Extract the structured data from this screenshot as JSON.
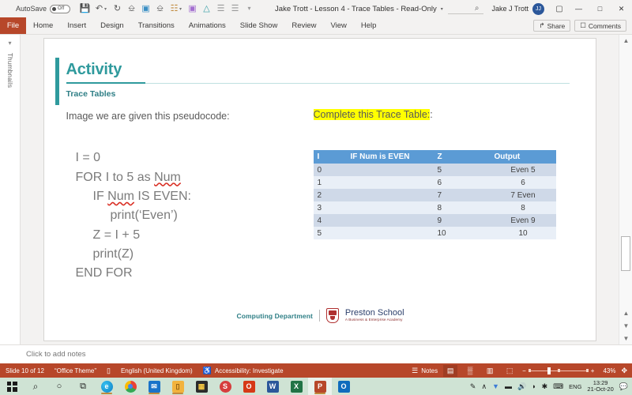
{
  "titlebar": {
    "autosave_label": "AutoSave",
    "autosave_state": "Off",
    "document_title": "Jake Trott - Lesson 4 - Trace Tables  -  Read-Only",
    "title_caret": "▾",
    "search_icon": "⌕",
    "account_name": "Jake J Trott",
    "avatar_initials": "JJ",
    "quick_access": [
      {
        "name": "save-icon",
        "glyph": "Ὃe"
      },
      {
        "name": "undo-icon",
        "glyph": "↶"
      },
      {
        "name": "redo-icon",
        "glyph": "↻"
      },
      {
        "name": "start-presentation-icon",
        "glyph": "⬚"
      },
      {
        "name": "text-box-icon",
        "glyph": "▣"
      },
      {
        "name": "new-slide-icon",
        "glyph": "⬚"
      },
      {
        "name": "picture-icon",
        "glyph": "Ὓc"
      },
      {
        "name": "shapes-icon",
        "glyph": "◰"
      },
      {
        "name": "format-painter-icon",
        "glyph": "✐"
      },
      {
        "name": "align-left-icon",
        "glyph": "☰"
      },
      {
        "name": "align-center-icon",
        "glyph": "☰"
      },
      {
        "name": "customize-qat-icon",
        "glyph": "☰"
      }
    ],
    "window_buttons": {
      "ribbon_display": "▢",
      "minimize": "—",
      "restore": "□",
      "close": "✕"
    }
  },
  "ribbon": {
    "file_label": "File",
    "tabs": [
      "Home",
      "Insert",
      "Design",
      "Transitions",
      "Animations",
      "Slide Show",
      "Review",
      "View",
      "Help"
    ],
    "share_label": "Share",
    "share_icon": "↱",
    "comments_label": "Comments",
    "comments_icon": "὞a"
  },
  "thumbnails_pane": {
    "label": "Thumbnails",
    "chevron": "▾"
  },
  "slide": {
    "title": "Activity",
    "subtitle": "Trace Tables",
    "prompt_left": "Image we are given this pseudocode:",
    "prompt_right": "Complete this Trace Table:",
    "code_lines": [
      {
        "indent": 0,
        "text": "I = 0"
      },
      {
        "indent": 0,
        "pre": "FOR I to 5 as ",
        "squiggle": "Num",
        "post": ""
      },
      {
        "indent": 1,
        "pre": "IF ",
        "squiggle": "Num",
        "post": " IS EVEN:"
      },
      {
        "indent": 2,
        "text": "print(‘Even’)"
      },
      {
        "indent": 1,
        "text": "Z = I + 5"
      },
      {
        "indent": 1,
        "text": "print(Z)"
      },
      {
        "indent": 0,
        "text": "END FOR"
      }
    ],
    "footer": {
      "department": "Computing Department",
      "school_name": "Preston School",
      "school_tagline": "A Business & Enterprise Academy"
    },
    "accent_color": "#2f9a9d",
    "highlight_color": "#ffff00"
  },
  "trace_table": {
    "headers": [
      "I",
      "IF Num is EVEN",
      "Z",
      "Output"
    ],
    "rows": [
      [
        "0",
        "",
        "5",
        "Even  5"
      ],
      [
        "1",
        "",
        "6",
        "6"
      ],
      [
        "2",
        "",
        "7",
        "7 Even"
      ],
      [
        "3",
        "",
        "8",
        "8"
      ],
      [
        "4",
        "",
        "9",
        "Even 9"
      ],
      [
        "5",
        "",
        "10",
        "10"
      ]
    ],
    "header_bg": "#5b9bd5",
    "row_odd_bg": "#cfd9e8",
    "row_even_bg": "#e9eff7"
  },
  "notes": {
    "placeholder": "Click to add notes"
  },
  "statusbar": {
    "slide_counter": "Slide 10 of 12",
    "theme": "“Office Theme”",
    "language": "English (United Kingdom)",
    "accessibility": "Accessibility: Investigate",
    "accessibility_icon": "♿",
    "theme_icon": "⬚",
    "notes_label": "Notes",
    "notes_icon": "☰",
    "view_normal_icon": "▤",
    "view_sorter_icon": "▒",
    "view_reading_icon": "▥",
    "view_show_icon": "⬚",
    "zoom_out": "−",
    "zoom_in": "+",
    "zoom_level": "43%",
    "fit_icon": "✥",
    "bg_color": "#b7472a"
  },
  "taskbar": {
    "items": [
      {
        "name": "start-button",
        "glyph": "",
        "label": "Start",
        "color": ""
      },
      {
        "name": "search-icon",
        "glyph": "⌕",
        "label": "Search",
        "color": ""
      },
      {
        "name": "cortana-icon",
        "glyph": "○",
        "label": "Cortana",
        "color": ""
      },
      {
        "name": "task-view-icon",
        "glyph": "⧉",
        "label": "Task View",
        "color": ""
      },
      {
        "name": "edge-icon",
        "glyph": "e",
        "label": "Microsoft Edge",
        "color": "#0f8fcf"
      },
      {
        "name": "chrome-icon",
        "glyph": "●",
        "label": "Google Chrome",
        "color": "#dd4b3e"
      },
      {
        "name": "mail-icon",
        "glyph": "✉",
        "label": "Mail",
        "color": "#1a73c9"
      },
      {
        "name": "file-explorer-icon",
        "glyph": "▭",
        "label": "File Explorer",
        "color": "#f2b33d"
      },
      {
        "name": "microsoft-store-icon",
        "glyph": "Ὤd",
        "label": "Microsoft Store",
        "color": "#2b2b2b"
      },
      {
        "name": "skype-icon",
        "glyph": "S",
        "label": "Skype",
        "color": "#d63d3d"
      },
      {
        "name": "office-icon",
        "glyph": "O",
        "label": "Office",
        "color": "#d63916"
      },
      {
        "name": "word-icon",
        "glyph": "W",
        "label": "Word",
        "color": "#2b579a"
      },
      {
        "name": "excel-icon",
        "glyph": "X",
        "label": "Excel",
        "color": "#217346"
      },
      {
        "name": "powerpoint-icon",
        "glyph": "P",
        "label": "PowerPoint",
        "color": "#b7472a",
        "active": true
      },
      {
        "name": "outlook-icon",
        "glyph": "O",
        "label": "Outlook",
        "color": "#0f6cbd"
      }
    ],
    "tray": {
      "pen_icon": "✎",
      "chevron_icon": "∧",
      "dropbox_icon": "▼",
      "battery_icon": "▬",
      "volume_icon": "ὐa",
      "wifi_icon": "◠",
      "bluetooth_icon": "✡",
      "keyboard_icon": "⌨",
      "language": "ENG",
      "time": "13:29",
      "date": "21-Oct-20",
      "notification_icon": "὞a"
    }
  }
}
